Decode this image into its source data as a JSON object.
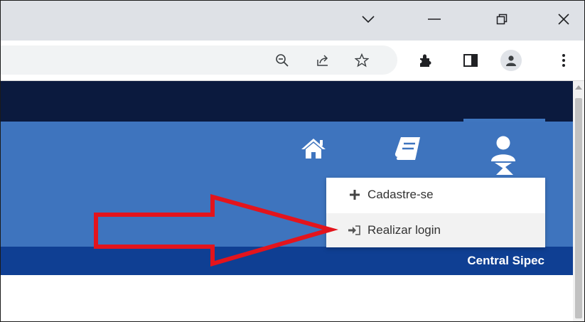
{
  "browser": {
    "window_controls": {
      "tab_search": "chevron-down-icon",
      "minimize": "minimize-icon",
      "restore": "restore-icon",
      "close": "close-icon"
    },
    "toolbar_icons": [
      "zoom-out-icon",
      "share-icon",
      "star-icon",
      "extensions-icon",
      "side-panel-icon",
      "profile-icon",
      "menu-icon"
    ]
  },
  "site": {
    "brand": "Central Sipec",
    "nav_icons": [
      "home-icon",
      "book-icon",
      "user-icon"
    ],
    "dropdown": {
      "items": [
        {
          "label": "Cadastre-se",
          "icon": "plus-icon"
        },
        {
          "label": "Realizar login",
          "icon": "sign-in-icon"
        }
      ]
    }
  },
  "annotation": {
    "arrow_color": "#e3141c"
  },
  "colors": {
    "top_band": "#0b1a3e",
    "nav_band": "#3e74be",
    "footer_band": "#0f3f93"
  }
}
